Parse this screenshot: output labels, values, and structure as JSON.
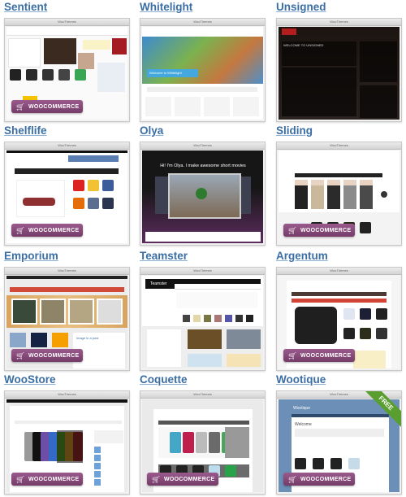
{
  "window_title": "WooThemes",
  "badge_label": "WOOCOMMERCE",
  "free_ribbon": "FREE",
  "colors": {
    "link": "#3a6ea5",
    "badge": "#7f4475",
    "ribbon": "#5a9e2f"
  },
  "themes": [
    {
      "name": "Sentient",
      "woocommerce": true,
      "style": "light-shop"
    },
    {
      "name": "Whitelight",
      "woocommerce": false,
      "style": "isometric",
      "hero_text": "Welcome to Whitelight"
    },
    {
      "name": "Unsigned",
      "woocommerce": false,
      "style": "dark-music",
      "hero_text": "WELCOME TO UNSIGNED"
    },
    {
      "name": "Shelflife",
      "woocommerce": true,
      "style": "shop-shoes"
    },
    {
      "name": "Olya",
      "woocommerce": false,
      "style": "dark-video",
      "hero_text": "Hi! I'm Olya. I make awesome short movies"
    },
    {
      "name": "Sliding",
      "woocommerce": true,
      "style": "fashion"
    },
    {
      "name": "Emporium",
      "woocommerce": true,
      "style": "wood-shop",
      "hero_text": "Image in a post"
    },
    {
      "name": "Teamster",
      "woocommerce": false,
      "style": "team",
      "hero_text": "Teamster"
    },
    {
      "name": "Argentum",
      "woocommerce": true,
      "style": "tee-shop"
    },
    {
      "name": "WooStore",
      "woocommerce": true,
      "style": "device-shop"
    },
    {
      "name": "Coquette",
      "woocommerce": true,
      "style": "ipod-shop"
    },
    {
      "name": "Wootique",
      "woocommerce": true,
      "style": "blue-shop",
      "free": true,
      "hero_text": "Welcome"
    }
  ]
}
